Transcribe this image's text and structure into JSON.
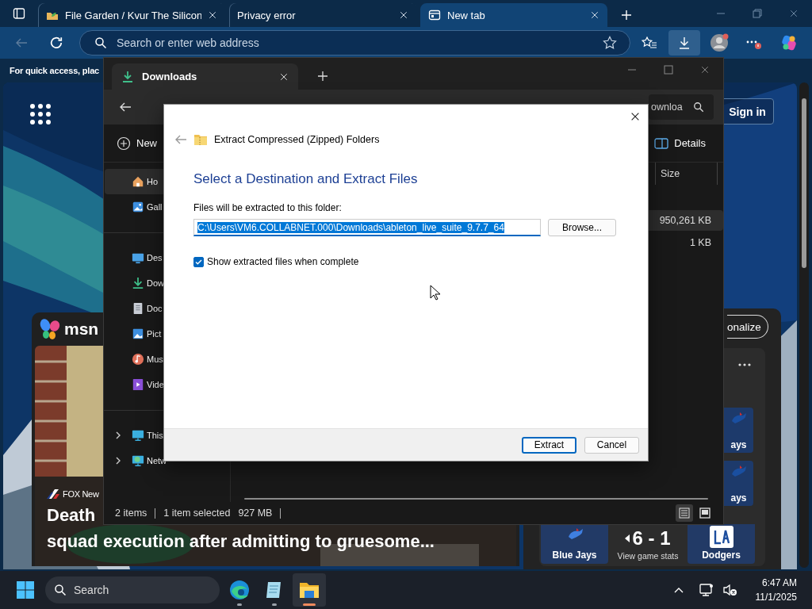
{
  "browser": {
    "tabs": [
      {
        "label": "File Garden / Kvur The Silicon",
        "selected": false,
        "kind": "folder"
      },
      {
        "label": "Privacy error",
        "selected": false,
        "kind": "none"
      },
      {
        "label": "New tab",
        "selected": true,
        "kind": "page"
      }
    ],
    "address_bar": {
      "placeholder": "Search or enter web address"
    },
    "favorites_hint": "For quick access, plac"
  },
  "new_tab": {
    "sign_in": "Sign in",
    "personalize": "onalize",
    "brand": "msn",
    "news": {
      "source": "FOX New",
      "headline": [
        "Death",
        "squad execution after admitting to gruesome..."
      ]
    },
    "scores": {
      "side_tiles": [
        "ays",
        "ays"
      ],
      "home_team": "Blue Jays",
      "score": "6 - 1",
      "score_link": "View game stats",
      "away_team": "Dodgers"
    }
  },
  "explorer": {
    "tab": "Downloads",
    "search": {
      "placeholder": "ownloa"
    },
    "commands": [
      "New",
      "Details"
    ],
    "sidebar": {
      "sections": [
        {
          "items": [
            {
              "label": "Ho",
              "kind": "home",
              "selected": true
            },
            {
              "label": "Gall",
              "kind": "gallery",
              "selected": false
            }
          ]
        },
        {
          "items": [
            {
              "label": "Des",
              "kind": "desktop",
              "selected": false
            },
            {
              "label": "Dow",
              "kind": "downloads",
              "selected": false
            },
            {
              "label": "Doc",
              "kind": "documents",
              "selected": false
            },
            {
              "label": "Pict",
              "kind": "pictures",
              "selected": false
            },
            {
              "label": "Mus",
              "kind": "music",
              "selected": false
            },
            {
              "label": "Vide",
              "kind": "videos",
              "selected": false
            }
          ]
        },
        {
          "items": [
            {
              "label": "This",
              "kind": "pc",
              "selected": false,
              "expanded": false
            },
            {
              "label": "Netw",
              "kind": "network",
              "selected": false,
              "expanded": false
            }
          ]
        }
      ]
    },
    "columns": [
      "Size"
    ],
    "rows": [
      {
        "size": "950,261 KB",
        "selected": true
      },
      {
        "size": "1 KB",
        "selected": false
      }
    ],
    "status": {
      "count": "2 items",
      "selection": "1 item selected",
      "selection_size": "927 MB"
    }
  },
  "dialog": {
    "title": "Extract Compressed (Zipped) Folders",
    "heading": "Select a Destination and Extract Files",
    "folder_label": "Files will be extracted to this folder:",
    "path": {
      "value": "C:\\Users\\VM6.COLLABNET.000\\Downloads\\ableton_live_suite_9.7.7_64",
      "text_selected": true
    },
    "browse": "Browse...",
    "show_files": {
      "label": "Show extracted files when complete",
      "checked": true
    },
    "buttons": [
      {
        "label": "Extract",
        "default": true
      },
      {
        "label": "Cancel",
        "default": false
      }
    ]
  },
  "taskbar": {
    "search": "Search",
    "apps": [
      {
        "kind": "browser",
        "active": false
      },
      {
        "kind": "notes",
        "active": false
      },
      {
        "kind": "files",
        "active": true
      }
    ],
    "time": "6:47 AM",
    "date": "11/1/2025"
  }
}
